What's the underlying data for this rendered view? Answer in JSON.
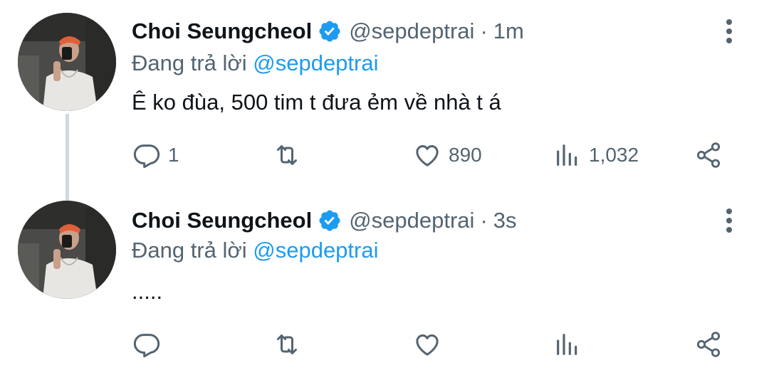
{
  "tweets": [
    {
      "display_name": "Choi Seungcheol",
      "handle": "@sepdeptrai",
      "separator": "·",
      "time": "1m",
      "replying_prefix": "Đang trả lời",
      "replying_mention": "@sepdeptrai",
      "text": "Ê ko đùa, 500 tim t đưa ẻm về nhà t á",
      "replies": "1",
      "retweets": "",
      "likes": "890",
      "views": "1,032"
    },
    {
      "display_name": "Choi Seungcheol",
      "handle": "@sepdeptrai",
      "separator": "·",
      "time": "3s",
      "replying_prefix": "Đang trả lời",
      "replying_mention": "@sepdeptrai",
      "text": ".....",
      "replies": "",
      "retweets": "",
      "likes": "",
      "views": ""
    }
  ],
  "colors": {
    "accent": "#1d9bf0",
    "secondary_text": "#536471",
    "primary_text": "#0f1419",
    "thread_line": "#cfd9de"
  },
  "icons": {
    "reply": "reply-icon",
    "retweet": "retweet-icon",
    "like": "heart-icon",
    "views": "views-icon",
    "share": "share-icon",
    "more": "more-vertical-icon",
    "verified": "verified-badge-icon"
  }
}
